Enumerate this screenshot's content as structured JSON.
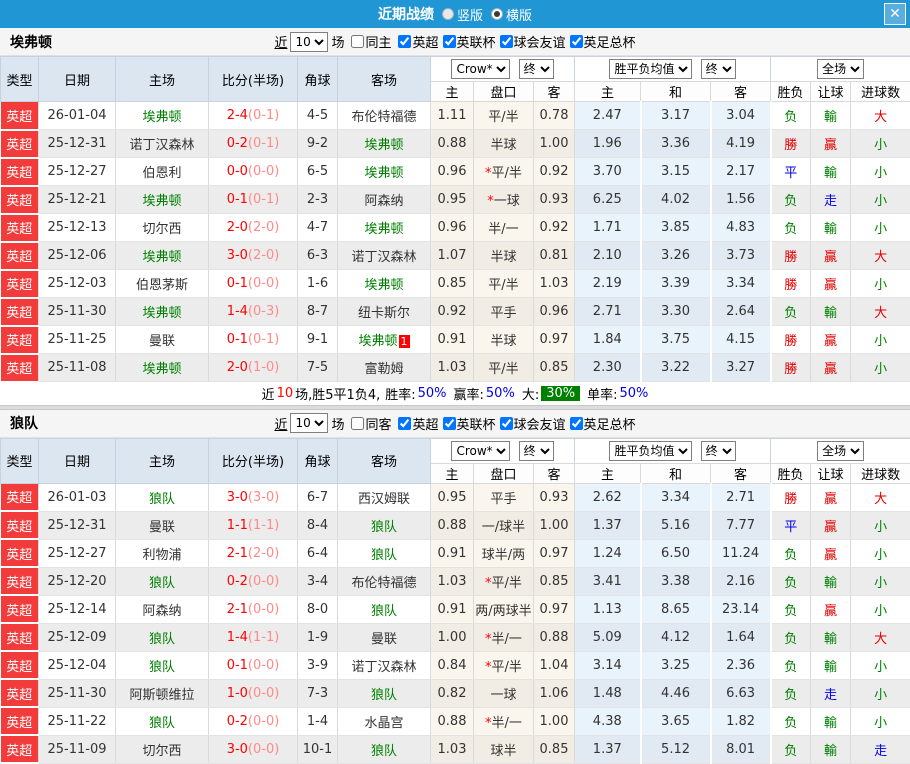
{
  "titlebar": {
    "title": "近期战绩",
    "view_options": [
      {
        "label": "竖版",
        "selected": false
      },
      {
        "label": "横版",
        "selected": true
      }
    ]
  },
  "icons": {
    "close": "✕"
  },
  "columns": {
    "type": "类型",
    "date": "日期",
    "home": "主场",
    "score": "比分(半场)",
    "corner": "角球",
    "away": "客场",
    "odds_home": "主",
    "odds_handicap": "盘口",
    "odds_away": "客",
    "avg_home": "主",
    "avg_draw": "和",
    "avg_away": "客",
    "result_wdl": "胜负",
    "result_handicap": "让球",
    "result_goals": "进球数"
  },
  "sections": [
    {
      "team": "埃弗顿",
      "near_label": "近",
      "games": "10",
      "games_suffix": "场",
      "same_label": "同主",
      "same_checked": false,
      "filters": [
        {
          "label": "英超",
          "checked": true
        },
        {
          "label": "英联杯",
          "checked": true
        },
        {
          "label": "球会友谊",
          "checked": true
        },
        {
          "label": "英足总杯",
          "checked": true
        }
      ],
      "dropdowns": {
        "bookmaker": "Crow*",
        "final_a": "终",
        "average": "胜平负均值",
        "final_b": "终",
        "scope": "全场"
      },
      "rows": [
        {
          "league": "英超",
          "date": "26-01-04",
          "home": "埃弗顿",
          "home_green": true,
          "score": "2-4",
          "half": "(0-1)",
          "corners": "4-5",
          "away": "布伦特福德",
          "away_green": false,
          "badge": "",
          "odds_home": "1.11",
          "handicap": "平/半",
          "star": false,
          "odds_away": "0.78",
          "avg_home": "2.47",
          "avg_draw": "3.17",
          "avg_away": "3.04",
          "result": "负",
          "handicap_result": "輸",
          "goals_result": "大"
        },
        {
          "league": "英超",
          "date": "25-12-31",
          "home": "诺丁汉森林",
          "home_green": false,
          "score": "0-2",
          "half": "(0-1)",
          "corners": "9-2",
          "away": "埃弗顿",
          "away_green": true,
          "badge": "",
          "odds_home": "0.88",
          "handicap": "半球",
          "star": false,
          "odds_away": "1.00",
          "avg_home": "1.96",
          "avg_draw": "3.36",
          "avg_away": "4.19",
          "result": "勝",
          "handicap_result": "贏",
          "goals_result": "小"
        },
        {
          "league": "英超",
          "date": "25-12-27",
          "home": "伯恩利",
          "home_green": false,
          "score": "0-0",
          "half": "(0-0)",
          "corners": "6-5",
          "away": "埃弗顿",
          "away_green": true,
          "badge": "",
          "odds_home": "0.96",
          "handicap": "平/半",
          "star": true,
          "odds_away": "0.92",
          "avg_home": "3.70",
          "avg_draw": "3.15",
          "avg_away": "2.17",
          "result": "平",
          "handicap_result": "輸",
          "goals_result": "小"
        },
        {
          "league": "英超",
          "date": "25-12-21",
          "home": "埃弗顿",
          "home_green": true,
          "score": "0-1",
          "half": "(0-1)",
          "corners": "2-3",
          "away": "阿森纳",
          "away_green": false,
          "badge": "",
          "odds_home": "0.95",
          "handicap": "一球",
          "star": true,
          "odds_away": "0.93",
          "avg_home": "6.25",
          "avg_draw": "4.02",
          "avg_away": "1.56",
          "result": "负",
          "handicap_result": "走",
          "goals_result": "小"
        },
        {
          "league": "英超",
          "date": "25-12-13",
          "home": "切尔西",
          "home_green": false,
          "score": "2-0",
          "half": "(2-0)",
          "corners": "4-7",
          "away": "埃弗顿",
          "away_green": true,
          "badge": "",
          "odds_home": "0.96",
          "handicap": "半/一",
          "star": false,
          "odds_away": "0.92",
          "avg_home": "1.71",
          "avg_draw": "3.85",
          "avg_away": "4.83",
          "result": "负",
          "handicap_result": "輸",
          "goals_result": "小"
        },
        {
          "league": "英超",
          "date": "25-12-06",
          "home": "埃弗顿",
          "home_green": true,
          "score": "3-0",
          "half": "(2-0)",
          "corners": "6-3",
          "away": "诺丁汉森林",
          "away_green": false,
          "badge": "",
          "odds_home": "1.07",
          "handicap": "半球",
          "star": false,
          "odds_away": "0.81",
          "avg_home": "2.10",
          "avg_draw": "3.26",
          "avg_away": "3.73",
          "result": "勝",
          "handicap_result": "贏",
          "goals_result": "大"
        },
        {
          "league": "英超",
          "date": "25-12-03",
          "home": "伯恩茅斯",
          "home_green": false,
          "score": "0-1",
          "half": "(0-0)",
          "corners": "1-6",
          "away": "埃弗顿",
          "away_green": true,
          "badge": "",
          "odds_home": "0.85",
          "handicap": "平/半",
          "star": false,
          "odds_away": "1.03",
          "avg_home": "2.19",
          "avg_draw": "3.39",
          "avg_away": "3.34",
          "result": "勝",
          "handicap_result": "贏",
          "goals_result": "小"
        },
        {
          "league": "英超",
          "date": "25-11-30",
          "home": "埃弗顿",
          "home_green": true,
          "score": "1-4",
          "half": "(0-3)",
          "corners": "8-7",
          "away": "纽卡斯尔",
          "away_green": false,
          "badge": "",
          "odds_home": "0.92",
          "handicap": "平手",
          "star": false,
          "odds_away": "0.96",
          "avg_home": "2.71",
          "avg_draw": "3.30",
          "avg_away": "2.64",
          "result": "负",
          "handicap_result": "輸",
          "goals_result": "大"
        },
        {
          "league": "英超",
          "date": "25-11-25",
          "home": "曼联",
          "home_green": false,
          "score": "0-1",
          "half": "(0-1)",
          "corners": "9-1",
          "away": "埃弗顿",
          "away_green": true,
          "badge": "1",
          "odds_home": "0.91",
          "handicap": "半球",
          "star": false,
          "odds_away": "0.97",
          "avg_home": "1.84",
          "avg_draw": "3.75",
          "avg_away": "4.15",
          "result": "勝",
          "handicap_result": "贏",
          "goals_result": "小"
        },
        {
          "league": "英超",
          "date": "25-11-08",
          "home": "埃弗顿",
          "home_green": true,
          "score": "2-0",
          "half": "(1-0)",
          "corners": "7-5",
          "away": "富勒姆",
          "away_green": false,
          "badge": "",
          "odds_home": "1.03",
          "handicap": "平/半",
          "star": false,
          "odds_away": "0.85",
          "avg_home": "2.30",
          "avg_draw": "3.22",
          "avg_away": "3.27",
          "result": "勝",
          "handicap_result": "贏",
          "goals_result": "小"
        }
      ],
      "summary": {
        "near": "近",
        "games": "10",
        "record": "场,胜5平1负4,",
        "win_label": "胜率:",
        "win": "50%",
        "yield_label": "赢率:",
        "yield": "50%",
        "big_label": "大:",
        "big": "30%",
        "single_label": "单率:",
        "single": "50%"
      }
    },
    {
      "team": "狼队",
      "near_label": "近",
      "games": "10",
      "games_suffix": "场",
      "same_label": "同客",
      "same_checked": false,
      "filters": [
        {
          "label": "英超",
          "checked": true
        },
        {
          "label": "英联杯",
          "checked": true
        },
        {
          "label": "球会友谊",
          "checked": true
        },
        {
          "label": "英足总杯",
          "checked": true
        }
      ],
      "dropdowns": {
        "bookmaker": "Crow*",
        "final_a": "终",
        "average": "胜平负均值",
        "final_b": "终",
        "scope": "全场"
      },
      "rows": [
        {
          "league": "英超",
          "date": "26-01-03",
          "home": "狼队",
          "home_green": true,
          "score": "3-0",
          "half": "(3-0)",
          "corners": "6-7",
          "away": "西汉姆联",
          "away_green": false,
          "badge": "",
          "odds_home": "0.95",
          "handicap": "平手",
          "star": false,
          "odds_away": "0.93",
          "avg_home": "2.62",
          "avg_draw": "3.34",
          "avg_away": "2.71",
          "result": "勝",
          "handicap_result": "贏",
          "goals_result": "大"
        },
        {
          "league": "英超",
          "date": "25-12-31",
          "home": "曼联",
          "home_green": false,
          "score": "1-1",
          "half": "(1-1)",
          "corners": "8-4",
          "away": "狼队",
          "away_green": true,
          "badge": "",
          "odds_home": "0.88",
          "handicap": "一/球半",
          "star": false,
          "odds_away": "1.00",
          "avg_home": "1.37",
          "avg_draw": "5.16",
          "avg_away": "7.77",
          "result": "平",
          "handicap_result": "贏",
          "goals_result": "小"
        },
        {
          "league": "英超",
          "date": "25-12-27",
          "home": "利物浦",
          "home_green": false,
          "score": "2-1",
          "half": "(2-0)",
          "corners": "6-4",
          "away": "狼队",
          "away_green": true,
          "badge": "",
          "odds_home": "0.91",
          "handicap": "球半/两",
          "star": false,
          "odds_away": "0.97",
          "avg_home": "1.24",
          "avg_draw": "6.50",
          "avg_away": "11.24",
          "result": "负",
          "handicap_result": "贏",
          "goals_result": "小"
        },
        {
          "league": "英超",
          "date": "25-12-20",
          "home": "狼队",
          "home_green": true,
          "score": "0-2",
          "half": "(0-0)",
          "corners": "3-4",
          "away": "布伦特福德",
          "away_green": false,
          "badge": "",
          "odds_home": "1.03",
          "handicap": "平/半",
          "star": true,
          "odds_away": "0.85",
          "avg_home": "3.41",
          "avg_draw": "3.38",
          "avg_away": "2.16",
          "result": "负",
          "handicap_result": "輸",
          "goals_result": "小"
        },
        {
          "league": "英超",
          "date": "25-12-14",
          "home": "阿森纳",
          "home_green": false,
          "score": "2-1",
          "half": "(0-0)",
          "corners": "8-0",
          "away": "狼队",
          "away_green": true,
          "badge": "",
          "odds_home": "0.91",
          "handicap": "两/两球半",
          "star": false,
          "odds_away": "0.97",
          "avg_home": "1.13",
          "avg_draw": "8.65",
          "avg_away": "23.14",
          "result": "负",
          "handicap_result": "贏",
          "goals_result": "小"
        },
        {
          "league": "英超",
          "date": "25-12-09",
          "home": "狼队",
          "home_green": true,
          "score": "1-4",
          "half": "(1-1)",
          "corners": "1-9",
          "away": "曼联",
          "away_green": false,
          "badge": "",
          "odds_home": "1.00",
          "handicap": "半/一",
          "star": true,
          "odds_away": "0.88",
          "avg_home": "5.09",
          "avg_draw": "4.12",
          "avg_away": "1.64",
          "result": "负",
          "handicap_result": "輸",
          "goals_result": "大"
        },
        {
          "league": "英超",
          "date": "25-12-04",
          "home": "狼队",
          "home_green": true,
          "score": "0-1",
          "half": "(0-0)",
          "corners": "3-9",
          "away": "诺丁汉森林",
          "away_green": false,
          "badge": "",
          "odds_home": "0.84",
          "handicap": "平/半",
          "star": true,
          "odds_away": "1.04",
          "avg_home": "3.14",
          "avg_draw": "3.25",
          "avg_away": "2.36",
          "result": "负",
          "handicap_result": "輸",
          "goals_result": "小"
        },
        {
          "league": "英超",
          "date": "25-11-30",
          "home": "阿斯顿维拉",
          "home_green": false,
          "score": "1-0",
          "half": "(0-0)",
          "corners": "7-3",
          "away": "狼队",
          "away_green": true,
          "badge": "",
          "odds_home": "0.82",
          "handicap": "一球",
          "star": false,
          "odds_away": "1.06",
          "avg_home": "1.48",
          "avg_draw": "4.46",
          "avg_away": "6.63",
          "result": "负",
          "handicap_result": "走",
          "goals_result": "小"
        },
        {
          "league": "英超",
          "date": "25-11-22",
          "home": "狼队",
          "home_green": true,
          "score": "0-2",
          "half": "(0-0)",
          "corners": "1-4",
          "away": "水晶宫",
          "away_green": false,
          "badge": "",
          "odds_home": "0.88",
          "handicap": "半/一",
          "star": true,
          "odds_away": "1.00",
          "avg_home": "4.38",
          "avg_draw": "3.65",
          "avg_away": "1.82",
          "result": "负",
          "handicap_result": "輸",
          "goals_result": "小"
        },
        {
          "league": "英超",
          "date": "25-11-09",
          "home": "切尔西",
          "home_green": false,
          "score": "3-0",
          "half": "(0-0)",
          "corners": "10-1",
          "away": "狼队",
          "away_green": true,
          "badge": "",
          "odds_home": "1.03",
          "handicap": "球半",
          "star": false,
          "odds_away": "0.85",
          "avg_home": "1.37",
          "avg_draw": "5.12",
          "avg_away": "8.01",
          "result": "负",
          "handicap_result": "輸",
          "goals_result": "走"
        }
      ],
      "summary": null
    }
  ]
}
